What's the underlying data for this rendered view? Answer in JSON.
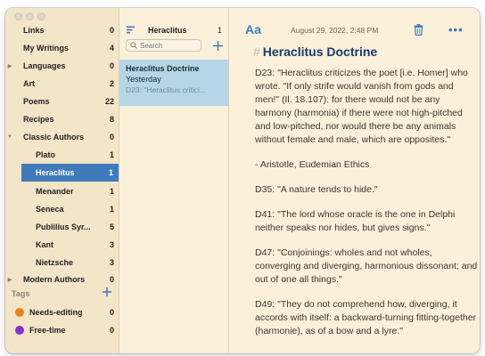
{
  "sidebar": {
    "items": [
      {
        "label": "Links",
        "count": "0",
        "disclosure": ""
      },
      {
        "label": "My Writings",
        "count": "4",
        "disclosure": ""
      },
      {
        "label": "Languages",
        "count": "0",
        "disclosure": "▶"
      },
      {
        "label": "Art",
        "count": "2",
        "disclosure": ""
      },
      {
        "label": "Poems",
        "count": "22",
        "disclosure": ""
      },
      {
        "label": "Recipes",
        "count": "8",
        "disclosure": ""
      },
      {
        "label": "Classic Authors",
        "count": "0",
        "disclosure": "▼"
      },
      {
        "label": "Plato",
        "count": "1",
        "disclosure": ""
      },
      {
        "label": "Heraclitus",
        "count": "1",
        "disclosure": ""
      },
      {
        "label": "Menander",
        "count": "1",
        "disclosure": ""
      },
      {
        "label": "Seneca",
        "count": "1",
        "disclosure": ""
      },
      {
        "label": "Publilius Syr...",
        "count": "5",
        "disclosure": ""
      },
      {
        "label": "Kant",
        "count": "3",
        "disclosure": ""
      },
      {
        "label": "Nietzsche",
        "count": "3",
        "disclosure": ""
      },
      {
        "label": "Modern Authors",
        "count": "0",
        "disclosure": "▶"
      }
    ],
    "tags_header": "Tags",
    "tags": [
      {
        "label": "Needs-editing",
        "count": "0",
        "color": "#e8841f"
      },
      {
        "label": "Free-time",
        "count": "0",
        "color": "#8b2fd0"
      }
    ]
  },
  "note_list": {
    "title": "Heraclitus",
    "count": "1",
    "search_placeholder": "Search",
    "notes": [
      {
        "title": "Heraclitus Doctrine",
        "date": "Yesterday",
        "preview": "D23: \"Heraclitus critici..."
      }
    ]
  },
  "editor": {
    "font_button": "Aa",
    "date": "August 29, 2022, 2:48 PM",
    "more": "•••",
    "title_hash": "#",
    "title": "Heraclitus Doctrine",
    "paragraphs": [
      "D23: \"Heraclitus criticizes the poet [i.e. Homer] who wrote. \"If only strife would vanish from gods and men!\" (Il. 18.107): for there would not be any harmony (harmonia) if there were not high-pitched and low-pitched, nor would there be any animals without female and male, which are opposites.\"",
      "- Aristotle, Eudemian Ethics",
      "D35: \"A nature tends to hide.\"",
      "D41: \"The lord whose oracle is the one in Delphi neither speaks nor hides, but gives signs.\"",
      "D47: \"Conjoinings: wholes and not wholes, converging and diverging, harmonious dissonant; and out of one all things.\"",
      "D49: \"They do not comprehend how, diverging, it accords with itself: a backward-turning fitting-together (harmonie), as of a bow and a lyre.\""
    ]
  },
  "colors": {
    "accent": "#3f7bbb",
    "background": "#fbf0da",
    "sidebar": "#f3e5c8",
    "selection": "#b5d6e6"
  }
}
